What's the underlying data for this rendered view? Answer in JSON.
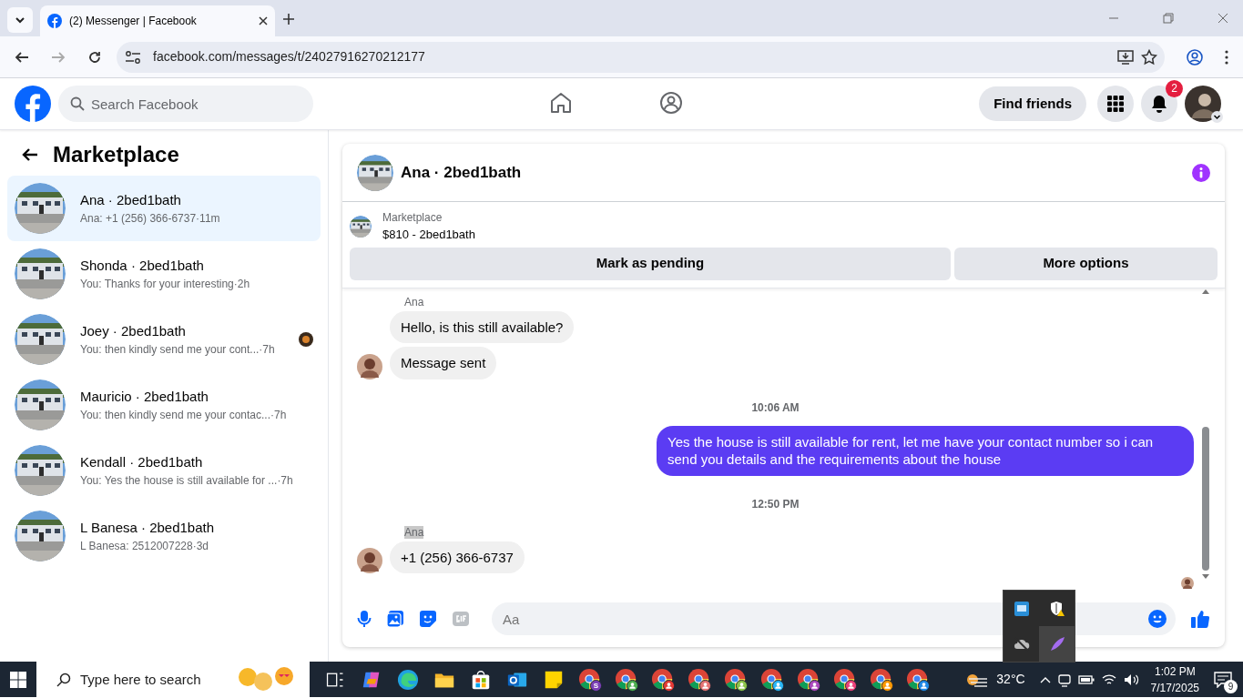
{
  "browser": {
    "tab_title": "(2) Messenger | Facebook",
    "url": "facebook.com/messages/t/24027916270212177"
  },
  "header": {
    "search_placeholder": "Search Facebook",
    "find_friends": "Find friends",
    "notification_count": "2"
  },
  "sidebar": {
    "title": "Marketplace",
    "conversations": [
      {
        "name": "Ana · 2bed1bath",
        "preview": "Ana: +1 (256) 366-6737",
        "time": "·11m",
        "selected": true,
        "seen_avatar": false
      },
      {
        "name": "Shonda · 2bed1bath",
        "preview": "You: Thanks for your interesting",
        "time": "·2h",
        "selected": false,
        "seen_avatar": false
      },
      {
        "name": "Joey · 2bed1bath",
        "preview": "You: then kindly send me your cont...",
        "time": "·7h",
        "selected": false,
        "seen_avatar": true
      },
      {
        "name": "Mauricio · 2bed1bath",
        "preview": "You: then kindly send me your contac...",
        "time": "·7h",
        "selected": false,
        "seen_avatar": false
      },
      {
        "name": "Kendall · 2bed1bath",
        "preview": "You: Yes the house is still available for ...",
        "time": "·7h",
        "selected": false,
        "seen_avatar": false
      },
      {
        "name": "L Banesa · 2bed1bath",
        "preview": "L Banesa: 2512007228",
        "time": "·3d",
        "selected": false,
        "seen_avatar": false
      }
    ]
  },
  "chat": {
    "title": "Ana · 2bed1bath",
    "listing": {
      "label": "Marketplace",
      "price": "$810 - 2bed1bath"
    },
    "buttons": [
      "Mark as pending",
      "More options"
    ],
    "messages": [
      {
        "kind": "sender",
        "text": "Ana",
        "highlighted": false
      },
      {
        "kind": "incoming",
        "text": "Hello, is this still available?",
        "avatar": false
      },
      {
        "kind": "incoming",
        "text": "Message sent",
        "avatar": true
      },
      {
        "kind": "time",
        "text": "10:06 AM"
      },
      {
        "kind": "outgoing",
        "text": "Yes the house is still available for rent, let me have your contact number so i can send you details and the requirements about the house"
      },
      {
        "kind": "time",
        "text": "12:50 PM"
      },
      {
        "kind": "sender",
        "text": "Ana",
        "highlighted": true
      },
      {
        "kind": "incoming",
        "text": "+1 (256) 366-6737",
        "avatar": true
      }
    ],
    "composer_placeholder": "Aa"
  },
  "taskbar": {
    "search_placeholder": "Type here to search",
    "apps": [
      {
        "kind": "taskview"
      },
      {
        "kind": "copilot"
      },
      {
        "kind": "edge"
      },
      {
        "kind": "explorer"
      },
      {
        "kind": "store"
      },
      {
        "kind": "outlook"
      },
      {
        "kind": "notes"
      },
      {
        "kind": "chrome",
        "color": "#7b3fb5",
        "letter": "S"
      },
      {
        "kind": "chrome",
        "color": "#4caf50"
      },
      {
        "kind": "chrome",
        "color": "#e53935"
      },
      {
        "kind": "chrome",
        "color": "#e57373"
      },
      {
        "kind": "chrome",
        "color": "#8bc34a"
      },
      {
        "kind": "chrome",
        "color": "#29b6f6"
      },
      {
        "kind": "chrome",
        "color": "#ab47bc"
      },
      {
        "kind": "chrome",
        "color": "#ec407a"
      },
      {
        "kind": "chrome",
        "color": "#ff9800"
      },
      {
        "kind": "chrome",
        "color": "#1e88e5"
      }
    ],
    "weather": "32°C",
    "time": "1:02 PM",
    "date": "7/17/2025",
    "notifications": "9"
  }
}
